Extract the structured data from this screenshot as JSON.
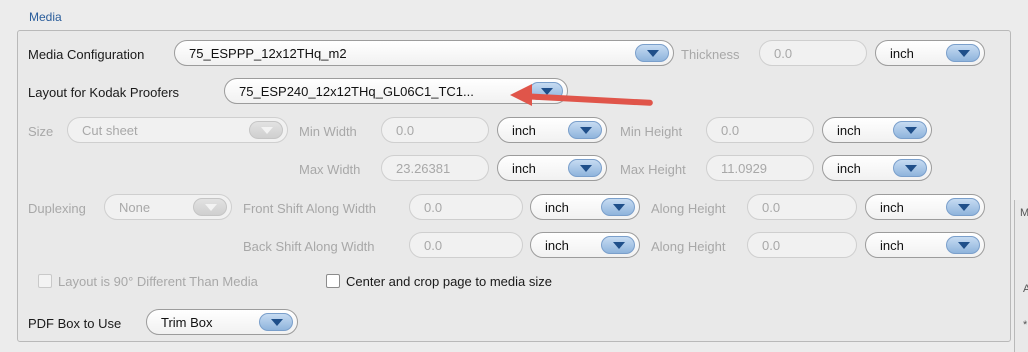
{
  "section_title": "Media",
  "media_configuration": {
    "label": "Media Configuration",
    "value": "75_ESPPP_12x12THq_m2"
  },
  "thickness": {
    "label": "Thickness",
    "value": "0.0",
    "unit": "inch"
  },
  "layout_kodak": {
    "label": "Layout for Kodak Proofers",
    "value": "75_ESP240_12x12THq_GL06C1_TC1..."
  },
  "size": {
    "label": "Size",
    "value": "Cut sheet"
  },
  "min_width": {
    "label": "Min Width",
    "value": "0.0",
    "unit": "inch"
  },
  "min_height": {
    "label": "Min Height",
    "value": "0.0",
    "unit": "inch"
  },
  "max_width": {
    "label": "Max Width",
    "value": "23.26381",
    "unit": "inch"
  },
  "max_height": {
    "label": "Max Height",
    "value": "11.0929",
    "unit": "inch"
  },
  "duplexing": {
    "label": "Duplexing",
    "value": "None"
  },
  "front_shift": {
    "label": "Front Shift Along Width",
    "value": "0.0",
    "unit": "inch"
  },
  "front_along_height": {
    "label": "Along Height",
    "value": "0.0",
    "unit": "inch"
  },
  "back_shift": {
    "label": "Back Shift Along Width",
    "value": "0.0",
    "unit": "inch"
  },
  "back_along_height": {
    "label": "Along Height",
    "value": "0.0",
    "unit": "inch"
  },
  "layout_90": {
    "label": "Layout is 90° Different Than Media"
  },
  "center_crop": {
    "label": "Center and crop page to media size"
  },
  "pdf_box": {
    "label": "PDF Box to Use",
    "value": "Trim Box"
  },
  "side_panel": {
    "letter_top": "M",
    "letter_mid": "A",
    "letter_bottom": "*"
  },
  "colors": {
    "accent": "#2a5d9b",
    "callout_arrow": "#e0554a",
    "dropdown_arrow": "#8fb4dc"
  }
}
